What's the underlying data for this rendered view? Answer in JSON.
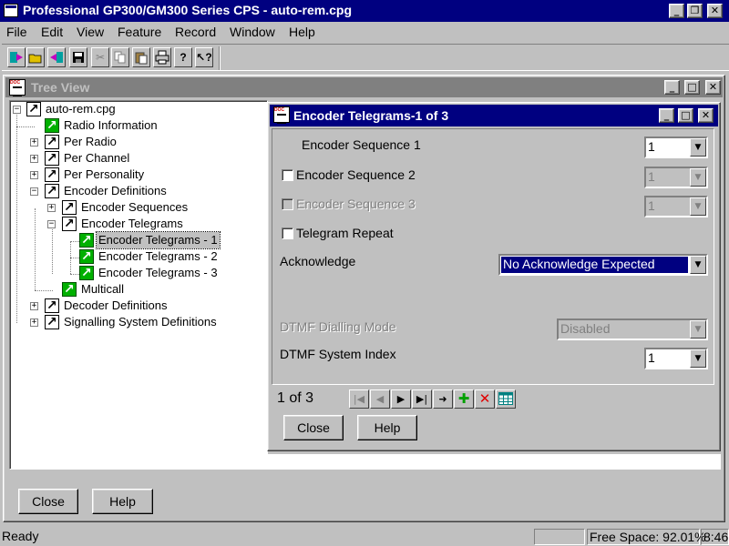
{
  "app": {
    "title": "Professional GP300/GM300 Series CPS - auto-rem.cpg"
  },
  "menu": {
    "items": [
      {
        "label": "File"
      },
      {
        "label": "Edit"
      },
      {
        "label": "View"
      },
      {
        "label": "Feature"
      },
      {
        "label": "Record"
      },
      {
        "label": "Window"
      },
      {
        "label": "Help"
      }
    ]
  },
  "toolbar": {
    "buttons": [
      "new-icon",
      "open-icon",
      "read-radio-icon",
      "save-icon",
      "cut-icon",
      "copy-icon",
      "paste-icon",
      "print-icon",
      "help-icon",
      "context-help-icon"
    ]
  },
  "tree_window": {
    "title": "Tree View",
    "root": "auto-rem.cpg",
    "nodes": [
      {
        "label": "Radio Information"
      },
      {
        "label": "Per Radio"
      },
      {
        "label": "Per Channel"
      },
      {
        "label": "Per Personality"
      },
      {
        "label": "Encoder Definitions"
      },
      {
        "label": "Encoder Sequences"
      },
      {
        "label": "Encoder Telegrams"
      },
      {
        "label": "Encoder Telegrams - 1"
      },
      {
        "label": "Encoder Telegrams - 2"
      },
      {
        "label": "Encoder Telegrams - 3"
      },
      {
        "label": "Multicall"
      },
      {
        "label": "Decoder Definitions"
      },
      {
        "label": "Signalling System Definitions"
      }
    ],
    "close_label": "Close",
    "help_label": "Help"
  },
  "dialog": {
    "title": "Encoder Telegrams-1 of 3",
    "encoder_sequence_1": {
      "label": "Encoder Sequence 1",
      "value": "1"
    },
    "encoder_sequence_2": {
      "label": "Encoder Sequence 2",
      "value": "1",
      "checked": false
    },
    "encoder_sequence_3": {
      "label": "Encoder Sequence 3",
      "value": "1",
      "checked": false
    },
    "telegram_repeat": {
      "label": "Telegram Repeat",
      "checked": false
    },
    "acknowledge": {
      "label": "Acknowledge",
      "value": "No Acknowledge Expected"
    },
    "dtmf_dialling_mode": {
      "label": "DTMF Dialling Mode",
      "value": "Disabled"
    },
    "dtmf_system_index": {
      "label": "DTMF System Index",
      "value": "1"
    },
    "record_position": "1 of 3",
    "close_label": "Close",
    "help_label": "Help"
  },
  "status": {
    "text": "Ready",
    "free_space": "Free Space: 92.01%",
    "time": "8:46"
  }
}
